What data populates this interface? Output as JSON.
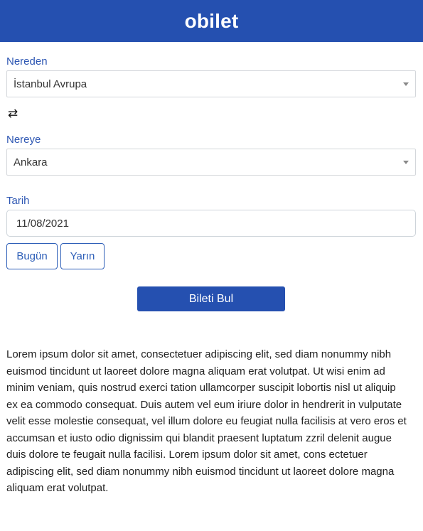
{
  "header": {
    "brand": "obilet"
  },
  "origin": {
    "label": "Nereden",
    "value": "İstanbul Avrupa"
  },
  "swap": {
    "icon": "swap-arrows-icon",
    "glyph": "⇄"
  },
  "destination": {
    "label": "Nereye",
    "value": "Ankara"
  },
  "date": {
    "label": "Tarih",
    "value": "11/08/2021"
  },
  "quick_dates": {
    "today": "Bugün",
    "tomorrow": "Yarın"
  },
  "search": {
    "button_label": "Bileti Bul"
  },
  "description": "Lorem ipsum dolor sit amet, consectetuer adipiscing elit, sed diam nonummy nibh euismod tincidunt ut laoreet dolore magna aliquam erat volutpat. Ut wisi enim ad minim veniam, quis nostrud exerci tation ullamcorper suscipit lobortis nisl ut aliquip ex ea commodo consequat. Duis autem vel eum iriure dolor in hendrerit in vulputate velit esse molestie consequat, vel illum dolore eu feugiat nulla facilisis at vero eros et accumsan et iusto odio dignissim qui blandit praesent luptatum zzril delenit augue duis dolore te feugait nulla facilisi. Lorem ipsum dolor sit amet, cons ectetuer adipiscing elit, sed diam nonummy nibh euismod tincidunt ut laoreet dolore magna aliquam erat volutpat.",
  "colors": {
    "brand": "#2550b0",
    "label": "#2e57b3",
    "outline_button": "#2e5fb8"
  }
}
